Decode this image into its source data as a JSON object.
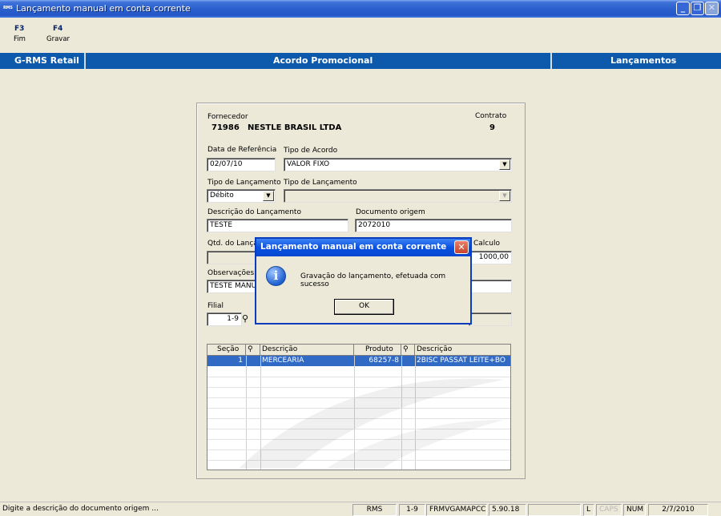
{
  "window": {
    "title": "Lançamento manual em conta corrente",
    "app_badge": "RMS"
  },
  "toolbar": {
    "f3_key": "F3",
    "f3_label": "Fim",
    "f4_key": "F4",
    "f4_label": "Gravar"
  },
  "header": {
    "app": "G-RMS Retail",
    "screen": "Acordo Promocional",
    "section": "Lançamentos"
  },
  "form": {
    "fornecedor_label": "Fornecedor",
    "fornecedor_code": "71986",
    "fornecedor_name": "NESTLE BRASIL LTDA",
    "contrato_label": "Contrato",
    "contrato_value": "9",
    "data_ref_label": "Data de Referência",
    "data_ref_value": "02/07/10",
    "tipo_acordo_label": "Tipo de  Acordo",
    "tipo_acordo_value": "VALOR FIXO",
    "tipo_lanc_label_1": "Tipo de Lançamento",
    "tipo_lanc_value_1": "Débito",
    "tipo_lanc_label_2": "Tipo de Lançamento",
    "tipo_lanc_value_2": "",
    "descricao_label": "Descrição do Lançamento",
    "descricao_value": "TESTE",
    "doc_origem_label": "Documento origem",
    "doc_origem_value": "2072010",
    "qtd_label": "Qtd. do Lança",
    "calculo_label": "Calculo",
    "calculo_value": "1000,00",
    "obs_label": "Observações",
    "obs_value": "TESTE MANU",
    "filial_label": "Filial",
    "filial_value": "1-9"
  },
  "grid": {
    "headers": [
      "Seção",
      "",
      "Descrição",
      "Produto",
      "",
      "Descrição"
    ],
    "rows": [
      {
        "secao": "1",
        "descricao": "MERCEARIA",
        "produto": "68257-8",
        "descricao_prod": "2BISC PASSAT LEITE+BO"
      }
    ]
  },
  "dialog": {
    "title": "Lançamento manual em conta corrente",
    "message": "Gravação do lançamento, efetuada com sucesso",
    "ok_label": "OK",
    "icon": "info-icon"
  },
  "statusbar": {
    "hint": "Digite a descrição do documento origem ...",
    "system": "RMS",
    "filial": "1-9",
    "form_id": "FRMVGAMAPCC",
    "version": "5.90.18",
    "lock": "L",
    "caps": "CAPS",
    "num": "NUM",
    "date": "2/7/2010"
  },
  "colors": {
    "header_blue": "#0d5aac",
    "selection": "#316ac5",
    "title_blue": "#2458c8"
  }
}
